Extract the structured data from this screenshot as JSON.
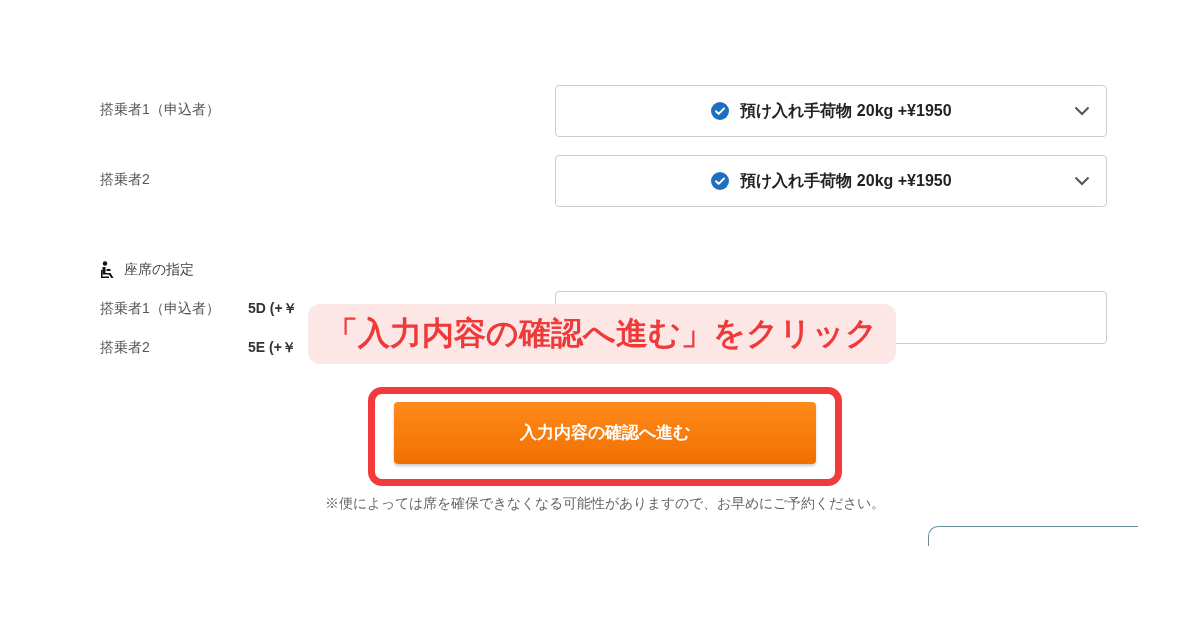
{
  "baggage": {
    "rows": [
      {
        "passenger": "搭乗者1（申込者）",
        "option": "預け入れ手荷物 20kg +¥1950",
        "checked": true
      },
      {
        "passenger": "搭乗者2",
        "option": "預け入れ手荷物 20kg +¥1950",
        "checked": true
      }
    ]
  },
  "seats": {
    "heading": "座席の指定",
    "rows": [
      {
        "passenger": "搭乗者1（申込者）",
        "seat": "5D (+￥"
      },
      {
        "passenger": "搭乗者2",
        "seat": "5E (+￥"
      }
    ]
  },
  "submit_button": "入力内容の確認へ進む",
  "note": "※便によっては席を確保できなくなる可能性がありますので、お早めにご予約ください。",
  "callout": "「入力内容の確認へ進む」をクリック"
}
